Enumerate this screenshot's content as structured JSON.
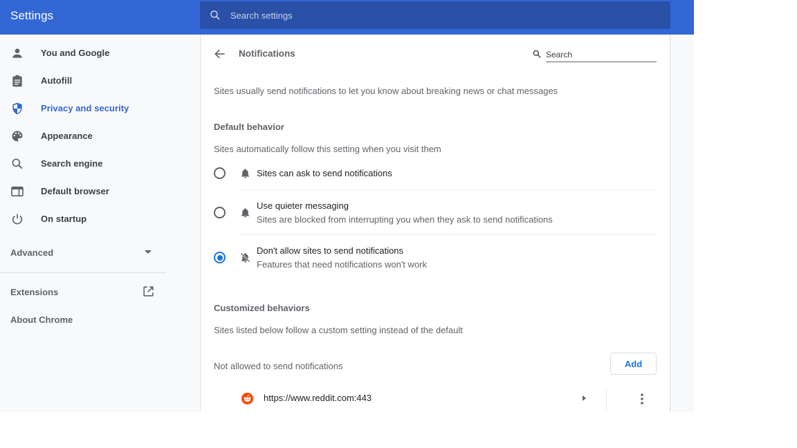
{
  "header": {
    "title": "Settings",
    "search_placeholder": "Search settings",
    "search_icon": "search-icon"
  },
  "sidebar": {
    "items": [
      {
        "label": "You and Google",
        "icon": "person-icon",
        "active": false
      },
      {
        "label": "Autofill",
        "icon": "clipboard-icon",
        "active": false
      },
      {
        "label": "Privacy and security",
        "icon": "shield-icon",
        "active": true
      },
      {
        "label": "Appearance",
        "icon": "palette-icon",
        "active": false
      },
      {
        "label": "Search engine",
        "icon": "search-icon",
        "active": false
      },
      {
        "label": "Default browser",
        "icon": "browser-window-icon",
        "active": false
      },
      {
        "label": "On startup",
        "icon": "power-icon",
        "active": false
      }
    ],
    "advanced": {
      "label": "Advanced",
      "icon": "caret-down-icon"
    },
    "extensions": {
      "label": "Extensions",
      "icon": "open-in-new-icon"
    },
    "about": {
      "label": "About Chrome"
    }
  },
  "page": {
    "title": "Notifications",
    "back_icon": "arrow-back-icon",
    "search_placeholder": "Search",
    "intro": "Sites usually send notifications to let you know about breaking news or chat messages",
    "default_behavior": {
      "heading": "Default behavior",
      "description": "Sites automatically follow this setting when you visit them",
      "options": [
        {
          "label": "Sites can ask to send notifications",
          "sublabel": "",
          "icon": "bell-icon",
          "checked": false
        },
        {
          "label": "Use quieter messaging",
          "sublabel": "Sites are blocked from interrupting you when they ask to send notifications",
          "icon": "bell-icon",
          "checked": false
        },
        {
          "label": "Don't allow sites to send notifications",
          "sublabel": "Features that need notifications won't work",
          "icon": "bell-off-icon",
          "checked": true
        }
      ]
    },
    "customized": {
      "heading": "Customized behaviors",
      "description": "Sites listed below follow a custom setting instead of the default",
      "blocked_list": {
        "label": "Not allowed to send notifications",
        "add_label": "Add",
        "sites": [
          {
            "url": "https://www.reddit.com:443",
            "favicon": "reddit-icon"
          }
        ]
      }
    }
  },
  "colors": {
    "header_bg": "#3367d6",
    "search_bg": "#2a50a8",
    "accent": "#1a73e8",
    "active_nav": "#3367d6",
    "reddit": "#ff4500"
  }
}
